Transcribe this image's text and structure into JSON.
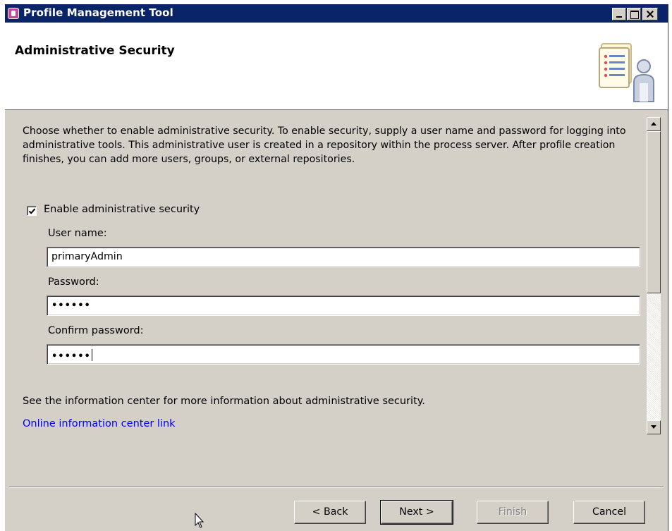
{
  "window": {
    "title": "Profile Management Tool"
  },
  "banner": {
    "title": "Administrative Security",
    "icon": "security-admin-icon"
  },
  "description": "Choose whether to enable administrative security. To enable security, supply a user name and password for logging into administrative tools. This administrative user is created in a repository within the process server. After profile creation finishes, you can add more users, groups, or external repositories.",
  "security": {
    "enable_label": "Enable administrative security",
    "enable_checked": true,
    "username_label": "User name:",
    "username_value": "primaryAdmin",
    "password_label": "Password:",
    "password_value": "••••••",
    "confirm_label": "Confirm password:",
    "confirm_value": "••••••"
  },
  "info": {
    "text": "See the information center for more information about administrative security.",
    "link_label": "Online information center link"
  },
  "buttons": {
    "back": "< Back",
    "next": "Next >",
    "finish": "Finish",
    "cancel": "Cancel"
  },
  "colors": {
    "titlebar": "#0a246a",
    "dialog": "#d4d0c8",
    "link": "#0000ff"
  }
}
